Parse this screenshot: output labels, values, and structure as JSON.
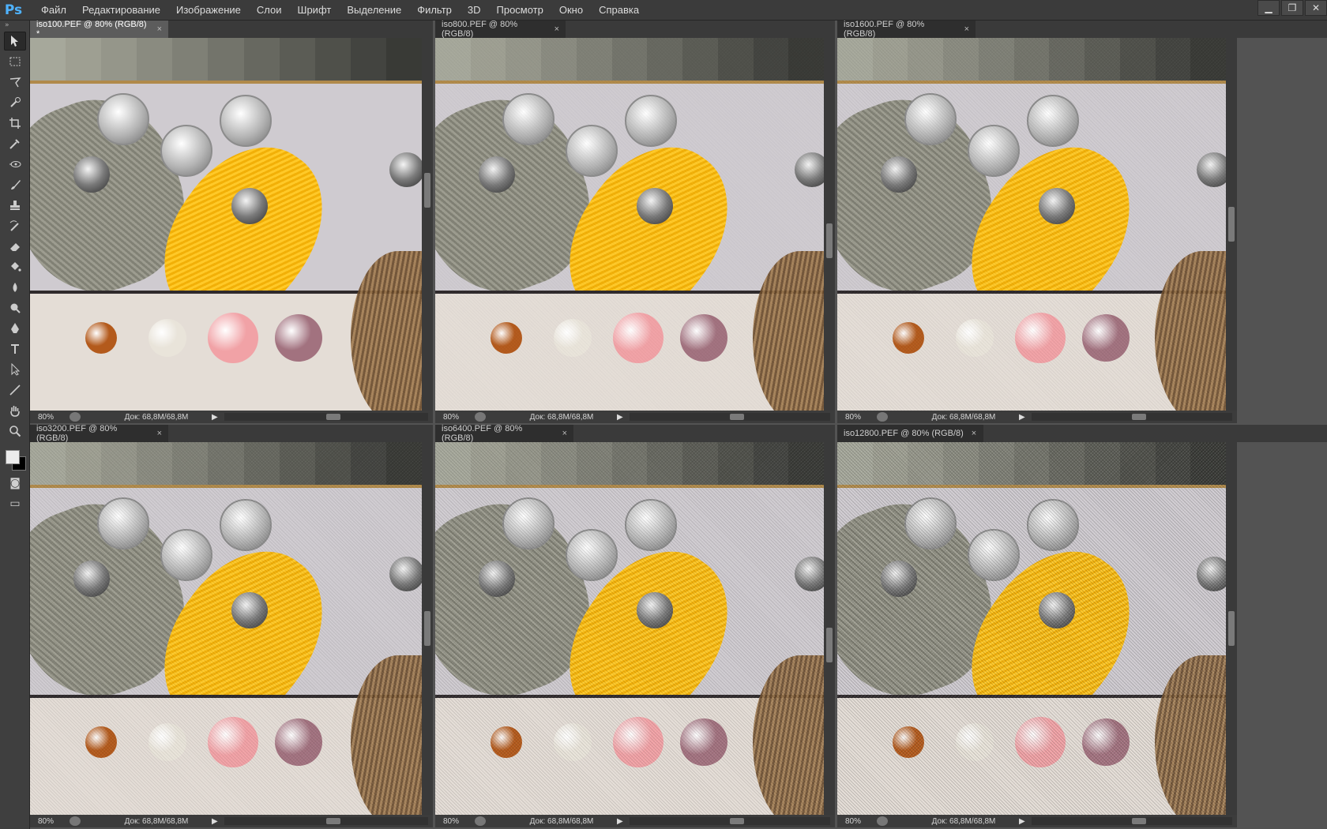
{
  "app": {
    "logo": "Ps"
  },
  "menu": [
    "Файл",
    "Редактирование",
    "Изображение",
    "Слои",
    "Шрифт",
    "Выделение",
    "Фильтр",
    "3D",
    "Просмотр",
    "Окно",
    "Справка"
  ],
  "window_controls": {
    "minimize": "▁",
    "restore": "❐",
    "close": "✕"
  },
  "documents": [
    {
      "title": "iso100.PEF @ 80% (RGB/8) *",
      "zoom": "80%",
      "doc_size": "Док: 68,8M/68,8M",
      "active": true
    },
    {
      "title": "iso800.PEF @ 80% (RGB/8)",
      "zoom": "80%",
      "doc_size": "Док: 68,8M/68,8M",
      "active": false
    },
    {
      "title": "iso1600.PEF @ 80% (RGB/8)",
      "zoom": "80%",
      "doc_size": "Док: 68,8M/68,8M",
      "active": false
    },
    {
      "title": "iso3200.PEF @ 80% (RGB/8)",
      "zoom": "80%",
      "doc_size": "Док: 68,8M/68,8M",
      "active": false
    },
    {
      "title": "iso6400.PEF @ 80% (RGB/8)",
      "zoom": "80%",
      "doc_size": "Док: 68,8M/68,8M",
      "active": false
    },
    {
      "title": "iso12800.PEF @ 80% (RGB/8)",
      "zoom": "80%",
      "doc_size": "Док: 68,8M/68,8M",
      "active": false
    }
  ],
  "tab_close": "×",
  "status_arrow": "▶",
  "tools": [
    "move-tool-icon",
    "marquee-tool-icon",
    "lasso-tool-icon",
    "quick-selection-icon",
    "crop-tool-icon",
    "eyedropper-icon",
    "healing-brush-icon",
    "brush-tool-icon",
    "clone-stamp-icon",
    "history-brush-icon",
    "eraser-icon",
    "paint-bucket-icon",
    "blur-tool-icon",
    "dodge-tool-icon",
    "pen-tool-icon",
    "type-tool-icon",
    "path-selection-icon",
    "line-tool-icon",
    "hand-tool-icon",
    "zoom-tool-icon"
  ],
  "colors": {
    "foreground": "#ececec",
    "background": "#000000",
    "ui_dark": "#3b3b3b",
    "accent_ps": "#4fb3ff"
  }
}
